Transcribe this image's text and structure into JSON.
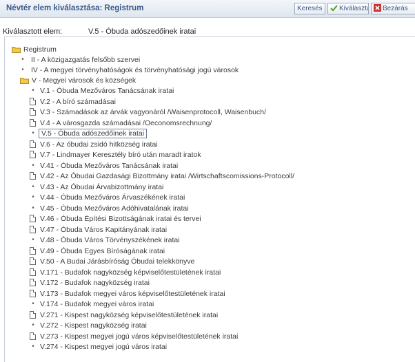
{
  "window": {
    "title": "Névtér elem kiválasztása: Registrum",
    "search_label": "Keresés",
    "select_label": "Kiválasztás",
    "close_label": "Bezárás"
  },
  "selected": {
    "label": "Kiválasztott elem:",
    "value": "V.5 - Óbuda adószedőinek iratai"
  },
  "tree": {
    "root": "Registrum",
    "level1": [
      "II - A közigazgatás felsőbb szervei",
      "IV - A megyei törvényhatóságok és törvényhatósági jogú városok",
      "V - Megyei városok és községek"
    ],
    "items": [
      {
        "label": "V.1 - Óbuda Mezőváros Tanácsának iratai",
        "icon": "bullet"
      },
      {
        "label": "V.2 - A bíró számadásai",
        "icon": "doc"
      },
      {
        "label": "V.3 - Számadások az árvák vagyonáról /Waisenprotocoll, Waisenbuch/",
        "icon": "doc"
      },
      {
        "label": "V.4 - A városgazda számadásai /Oeconomsrechnung/",
        "icon": "doc"
      },
      {
        "label": "V.5 - Óbuda adószedőinek iratai",
        "icon": "bullet",
        "active": true
      },
      {
        "label": "V.6 - Az óbudai zsidó hitközség iratai",
        "icon": "doc"
      },
      {
        "label": "V.7 - Lindmayer Keresztély bíró után maradt iratok",
        "icon": "doc"
      },
      {
        "label": "V.41 - Óbuda Mezőváros Tanácsának iratai",
        "icon": "bullet"
      },
      {
        "label": "V.42 - Az Óbudai Gazdasági Bizottmány iratai /Wirtschaftscomissions-Protocoll/",
        "icon": "doc"
      },
      {
        "label": "V.43 - Az Óbudai Árvabizottmány iratai",
        "icon": "bullet"
      },
      {
        "label": "V.44 - Óbuda Mezőváros Árvaszékének iratai",
        "icon": "bullet"
      },
      {
        "label": "V.45 - Óbuda Mezőváros Adóhivatalának iratai",
        "icon": "bullet"
      },
      {
        "label": "V.46 - Óbuda Építési Bizottságának iratai és tervei",
        "icon": "doc"
      },
      {
        "label": "V.47 - Óbuda Város Kapitányának iratai",
        "icon": "doc"
      },
      {
        "label": "V.48 - Óbuda Város Törvényszékének iratai",
        "icon": "bullet"
      },
      {
        "label": "V.49 - Óbuda Egyes Bíróságának iratai",
        "icon": "doc"
      },
      {
        "label": "V.50 - A Budai Járásbíróság Óbudai telekkönyve",
        "icon": "doc"
      },
      {
        "label": "V.171 - Budafok nagyközség képviselőtestületének iratai",
        "icon": "doc"
      },
      {
        "label": "V.172 - Budafok nagyközség iratai",
        "icon": "doc"
      },
      {
        "label": "V.173 - Budafok megyei város képviselőtestületének iratai",
        "icon": "doc"
      },
      {
        "label": "V.174 - Budafok megyei város iratai",
        "icon": "bullet"
      },
      {
        "label": "V.271 - Kispest nagyközség képviselőtestületének iratai",
        "icon": "doc"
      },
      {
        "label": "V.272 - Kispest nagyközség iratai",
        "icon": "bullet"
      },
      {
        "label": "V.273 - Kispest megyei jogú város képviselőtestületének iratai",
        "icon": "doc"
      },
      {
        "label": "V.274 - Kispest megyei jogú város iratai",
        "icon": "bullet"
      }
    ]
  },
  "colors": {
    "title": "#3b5a8a",
    "folder": "#f2c94c",
    "check": "#4aa02c",
    "close": "#cc3333"
  }
}
